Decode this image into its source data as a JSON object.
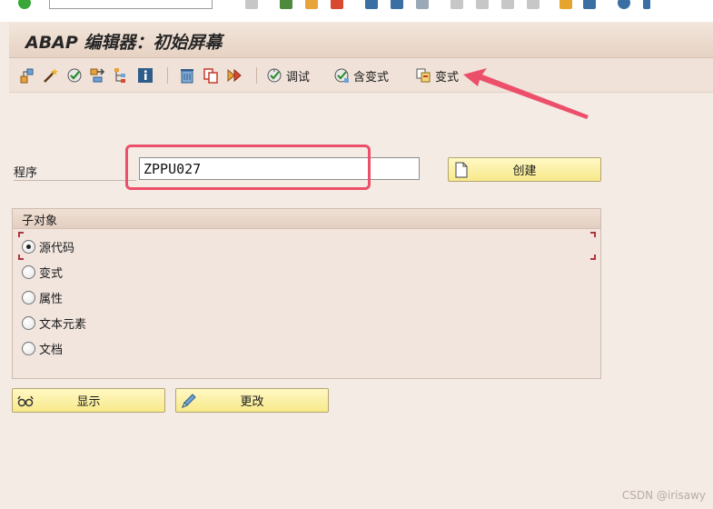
{
  "title": "ABAP 编辑器：初始屏幕",
  "toolbar": {
    "debug_label": "调试",
    "with_variant_label": "含变式",
    "variant_label": "变式"
  },
  "program": {
    "label": "程序",
    "value": "ZPPU027",
    "create_label": "创建"
  },
  "subobjects": {
    "title": "子对象",
    "options": [
      {
        "label": "源代码",
        "checked": true
      },
      {
        "label": "变式",
        "checked": false
      },
      {
        "label": "属性",
        "checked": false
      },
      {
        "label": "文本元素",
        "checked": false
      },
      {
        "label": "文档",
        "checked": false
      }
    ]
  },
  "actions": {
    "display_label": "显示",
    "change_label": "更改"
  },
  "watermark": "CSDN @irisawy",
  "colors": {
    "highlight": "#ec4f6a",
    "button_yellow": "#f7e98a",
    "background": "#f4ebe5"
  }
}
